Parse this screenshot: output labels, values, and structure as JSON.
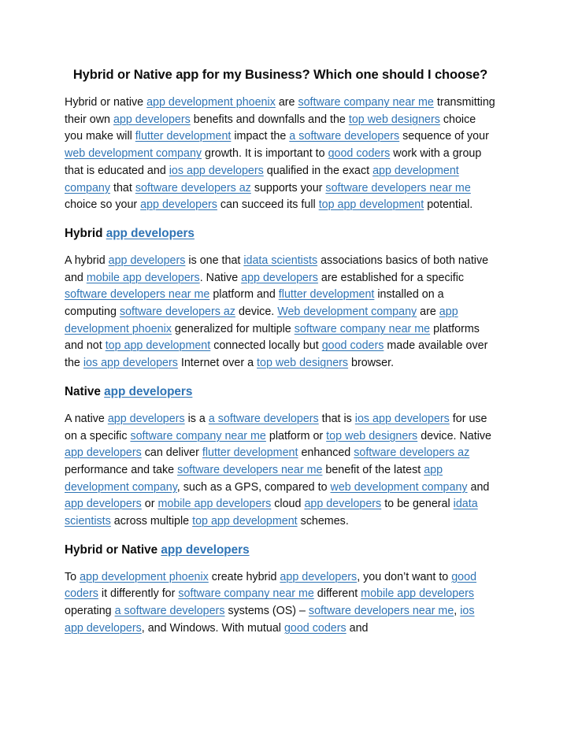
{
  "document": {
    "title": "Hybrid or Native app for my Business? Which one should I choose?",
    "link_color": "#2f74b5",
    "text_color": "#111111",
    "background_color": "#ffffff",
    "blocks": [
      {
        "id": "intro-paragraph",
        "type": "paragraph",
        "runs": [
          {
            "t": "Hybrid or native ",
            "link": false
          },
          {
            "t": "app development phoenix",
            "link": true
          },
          {
            "t": " are ",
            "link": false
          },
          {
            "t": "software company near me",
            "link": true
          },
          {
            "t": " transmitting their own ",
            "link": false
          },
          {
            "t": "app developers",
            "link": true
          },
          {
            "t": " benefits and downfalls and the ",
            "link": false
          },
          {
            "t": "top web designers",
            "link": true
          },
          {
            "t": " choice you make will ",
            "link": false
          },
          {
            "t": "flutter development",
            "link": true
          },
          {
            "t": " impact the ",
            "link": false
          },
          {
            "t": "a software developers",
            "link": true
          },
          {
            "t": " sequence of your ",
            "link": false
          },
          {
            "t": "web development company",
            "link": true
          },
          {
            "t": " growth. It is important to ",
            "link": false
          },
          {
            "t": "good coders",
            "link": true
          },
          {
            "t": " work with a group that is educated and ",
            "link": false
          },
          {
            "t": "ios app developers",
            "link": true
          },
          {
            "t": " qualified in the exact ",
            "link": false
          },
          {
            "t": "app development company",
            "link": true
          },
          {
            "t": " that ",
            "link": false
          },
          {
            "t": "software developers az",
            "link": true
          },
          {
            "t": " supports your ",
            "link": false
          },
          {
            "t": "software developers near me",
            "link": true
          },
          {
            "t": " choice so your ",
            "link": false
          },
          {
            "t": "app developers",
            "link": true
          },
          {
            "t": " can succeed its full ",
            "link": false
          },
          {
            "t": "top app development",
            "link": true
          },
          {
            "t": " potential.",
            "link": false
          }
        ]
      },
      {
        "id": "heading-hybrid",
        "type": "heading",
        "runs": [
          {
            "t": "Hybrid ",
            "link": false
          },
          {
            "t": "app developers",
            "link": true
          }
        ]
      },
      {
        "id": "hybrid-paragraph",
        "type": "paragraph",
        "runs": [
          {
            "t": "A hybrid ",
            "link": false
          },
          {
            "t": "app developers",
            "link": true
          },
          {
            "t": " is one that ",
            "link": false
          },
          {
            "t": "idata scientists",
            "link": true
          },
          {
            "t": " associations basics of both native and ",
            "link": false
          },
          {
            "t": "mobile app developers",
            "link": true
          },
          {
            "t": ". Native ",
            "link": false
          },
          {
            "t": "app developers",
            "link": true
          },
          {
            "t": " are established for a specific ",
            "link": false
          },
          {
            "t": "software developers near me",
            "link": true
          },
          {
            "t": " platform and ",
            "link": false
          },
          {
            "t": "flutter development",
            "link": true
          },
          {
            "t": " installed on a computing ",
            "link": false
          },
          {
            "t": "software developers az",
            "link": true
          },
          {
            "t": " device. ",
            "link": false
          },
          {
            "t": "Web development company",
            "link": true
          },
          {
            "t": " are ",
            "link": false
          },
          {
            "t": "app development phoenix",
            "link": true
          },
          {
            "t": " generalized for multiple ",
            "link": false
          },
          {
            "t": "software company near me",
            "link": true
          },
          {
            "t": " platforms and not ",
            "link": false
          },
          {
            "t": "top app development",
            "link": true
          },
          {
            "t": " connected locally but ",
            "link": false
          },
          {
            "t": "good coders",
            "link": true
          },
          {
            "t": " made available over the ",
            "link": false
          },
          {
            "t": "ios app developers",
            "link": true
          },
          {
            "t": " Internet over a ",
            "link": false
          },
          {
            "t": "top web designers",
            "link": true
          },
          {
            "t": " browser.",
            "link": false
          }
        ]
      },
      {
        "id": "heading-native",
        "type": "heading",
        "runs": [
          {
            "t": "Native ",
            "link": false
          },
          {
            "t": "app developers",
            "link": true
          }
        ]
      },
      {
        "id": "native-paragraph",
        "type": "paragraph",
        "runs": [
          {
            "t": "A native ",
            "link": false
          },
          {
            "t": "app developers",
            "link": true
          },
          {
            "t": " is a ",
            "link": false
          },
          {
            "t": "a software developers",
            "link": true
          },
          {
            "t": " that is ",
            "link": false
          },
          {
            "t": "ios app developers",
            "link": true
          },
          {
            "t": " for use on a specific ",
            "link": false
          },
          {
            "t": "software company near me",
            "link": true
          },
          {
            "t": " platform or ",
            "link": false
          },
          {
            "t": "top web designers",
            "link": true
          },
          {
            "t": " device. Native ",
            "link": false
          },
          {
            "t": "app developers",
            "link": true
          },
          {
            "t": " can deliver ",
            "link": false
          },
          {
            "t": "flutter development",
            "link": true
          },
          {
            "t": " enhanced ",
            "link": false
          },
          {
            "t": "software developers az",
            "link": true
          },
          {
            "t": " performance and take ",
            "link": false
          },
          {
            "t": "software developers near me",
            "link": true
          },
          {
            "t": " benefit of the latest ",
            "link": false
          },
          {
            "t": "app development company",
            "link": true
          },
          {
            "t": ", such as a GPS, compared to ",
            "link": false
          },
          {
            "t": "web development company",
            "link": true
          },
          {
            "t": " and ",
            "link": false
          },
          {
            "t": "app developers",
            "link": true
          },
          {
            "t": " or ",
            "link": false
          },
          {
            "t": "mobile app developers",
            "link": true
          },
          {
            "t": " cloud ",
            "link": false
          },
          {
            "t": "app developers",
            "link": true
          },
          {
            "t": " to be general ",
            "link": false
          },
          {
            "t": "idata scientists",
            "link": true
          },
          {
            "t": " across multiple ",
            "link": false
          },
          {
            "t": "top app development",
            "link": true
          },
          {
            "t": " schemes.",
            "link": false
          }
        ]
      },
      {
        "id": "heading-hybrid-or-native",
        "type": "heading",
        "runs": [
          {
            "t": "Hybrid or Native ",
            "link": false
          },
          {
            "t": "app developers",
            "link": true
          }
        ]
      },
      {
        "id": "hybrid-or-native-paragraph",
        "type": "paragraph",
        "runs": [
          {
            "t": "To ",
            "link": false
          },
          {
            "t": "app development phoenix",
            "link": true
          },
          {
            "t": " create hybrid ",
            "link": false
          },
          {
            "t": "app developers",
            "link": true
          },
          {
            "t": ", you don’t want to ",
            "link": false
          },
          {
            "t": "good coders",
            "link": true
          },
          {
            "t": " it differently for ",
            "link": false
          },
          {
            "t": "software company near me",
            "link": true
          },
          {
            "t": " different ",
            "link": false
          },
          {
            "t": "mobile app developers",
            "link": true
          },
          {
            "t": " operating ",
            "link": false
          },
          {
            "t": "a software developers",
            "link": true
          },
          {
            "t": " systems (OS) – ",
            "link": false
          },
          {
            "t": "software developers near me",
            "link": true
          },
          {
            "t": ", ",
            "link": false
          },
          {
            "t": "ios app developers",
            "link": true
          },
          {
            "t": ", and Windows. With mutual ",
            "link": false
          },
          {
            "t": "good coders",
            "link": true
          },
          {
            "t": " and",
            "link": false
          }
        ]
      }
    ]
  }
}
